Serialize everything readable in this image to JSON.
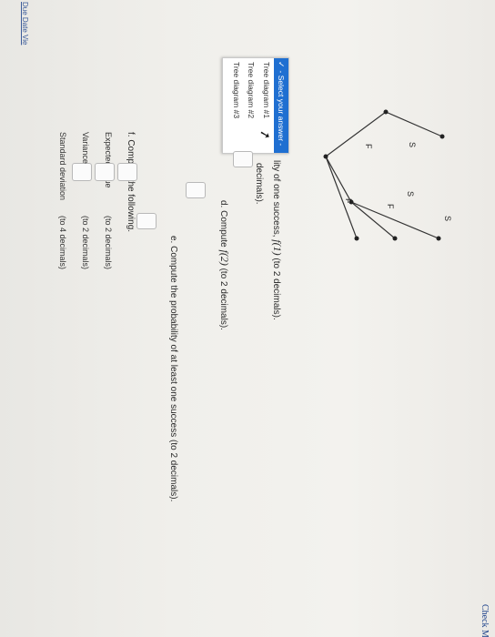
{
  "dropdown": {
    "selected": "- Select your answer -",
    "options": [
      "Tree diagram #1",
      "Tree diagram #2",
      "Tree diagram #3"
    ]
  },
  "question_c": {
    "partial_text": "lity of one success,",
    "formula": "f(1)",
    "suffix": "(to 2 decimals).",
    "partial_line2": "decimals)."
  },
  "question_d": {
    "text": "d. Compute",
    "formula": "f(2)",
    "suffix": "(to 2 decimals)."
  },
  "question_e": {
    "text": "e. Compute the probability of at least one success (to 2 decimals)."
  },
  "question_f": {
    "heading": "f. Compute the following.",
    "rows": [
      {
        "label": "Expected value",
        "hint": "(to 2 decimals)"
      },
      {
        "label": "Variance",
        "hint": "(to 2 decimals)"
      },
      {
        "label": "Standard deviation",
        "hint": "(to 4 decimals)"
      }
    ]
  },
  "tree": {
    "labels": [
      "S",
      "F",
      "S",
      "F",
      "F",
      "S"
    ]
  },
  "footer": {
    "check_button": "Check M",
    "partial_link": "Due Date Vie"
  }
}
